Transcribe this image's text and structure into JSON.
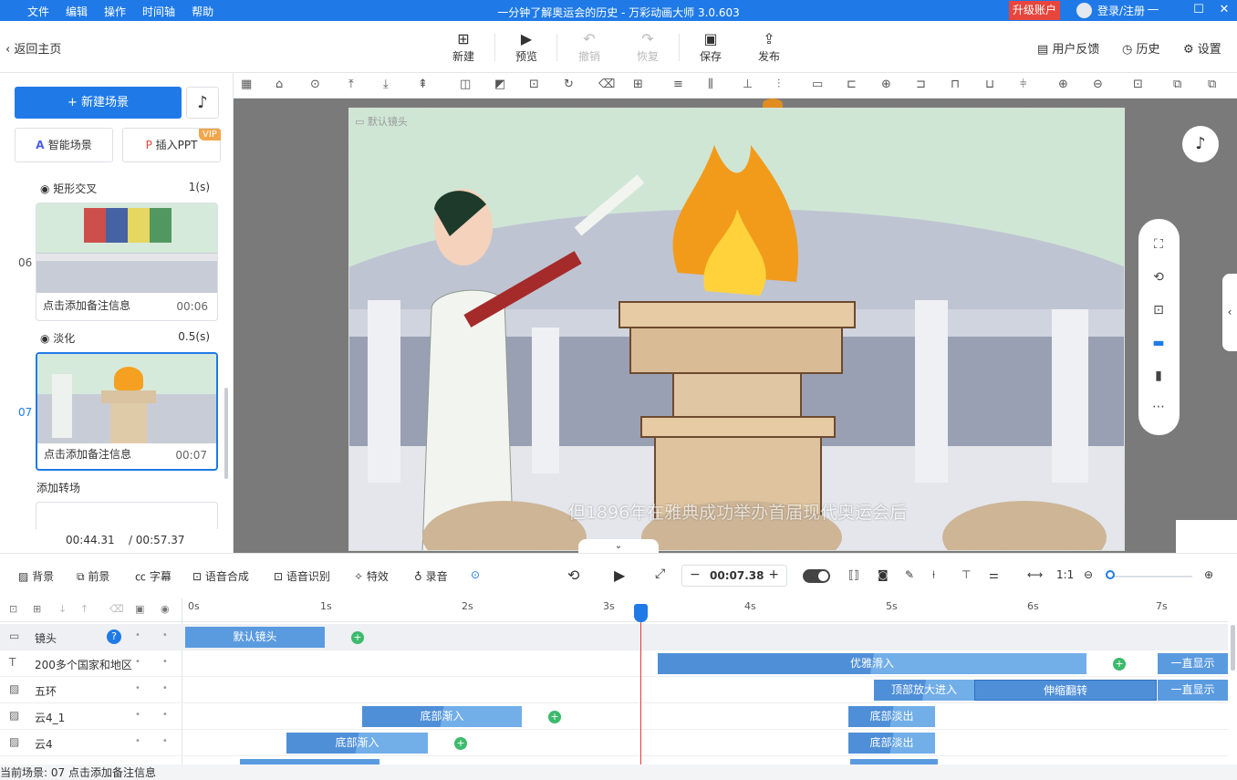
{
  "window": {
    "menu": [
      "文件",
      "编辑",
      "操作",
      "时间轴",
      "帮助"
    ],
    "title": "一分钟了解奥运会的历史 - 万彩动画大师 3.0.603",
    "upgrade": "升级账户",
    "login": "登录/注册"
  },
  "toolbar": {
    "back": "返回主页",
    "new": "新建",
    "preview": "预览",
    "undo": "撤销",
    "redo": "恢复",
    "save": "保存",
    "publish": "发布",
    "feedback": "用户反馈",
    "history": "历史",
    "settings": "设置"
  },
  "left": {
    "new_scene": "+ 新建场景",
    "smart_scene": "智能场景",
    "insert_ppt": "插入PPT",
    "vip": "VIP",
    "scenes": [
      {
        "transition": "矩形交叉",
        "transition_dur": "1(s)",
        "no": "06",
        "note": "点击添加备注信息",
        "time": "00:06"
      },
      {
        "transition": "淡化",
        "transition_dur": "0.5(s)",
        "no": "07",
        "note": "点击添加备注信息",
        "time": "00:07"
      }
    ],
    "add_transition": "添加转场",
    "current_time": "00:44.31",
    "total_time": "/ 00:57.37"
  },
  "canvas": {
    "camera_label": "默认镜头",
    "subtitle": "但1896年在雅典成功举办首届现代奥运会后"
  },
  "timeline_toolbar": {
    "bg": "背景",
    "fg": "前景",
    "caption": "字幕",
    "tts": "语音合成",
    "asr": "语音识别",
    "fx": "特效",
    "record": "录音",
    "time": "00:07.38"
  },
  "timeline": {
    "ruler": [
      "0s",
      "1s",
      "2s",
      "3s",
      "4s",
      "5s",
      "6s",
      "7s"
    ],
    "tracks": [
      {
        "name": "镜头",
        "icon": "camera",
        "clips": [
          {
            "label": "默认镜头"
          }
        ]
      },
      {
        "name": "200多个国家和地区",
        "icon": "text",
        "clips": [
          {
            "label": "优雅滑入"
          },
          {
            "label": "一直显示"
          }
        ]
      },
      {
        "name": "五环",
        "icon": "image",
        "clips": [
          {
            "label": "顶部放大进入"
          },
          {
            "label": "伸缩翻转"
          },
          {
            "label": "一直显示"
          }
        ]
      },
      {
        "name": "云4_1",
        "icon": "image",
        "clips": [
          {
            "label": "底部渐入"
          },
          {
            "label": "底部淡出"
          }
        ]
      },
      {
        "name": "云4",
        "icon": "image",
        "clips": [
          {
            "label": "底部渐入"
          },
          {
            "label": "底部淡出"
          }
        ]
      }
    ]
  },
  "status": "当前场景: 07    点击添加备注信息",
  "colors": {
    "accent": "#1f7ae8",
    "upgrade": "#e8453c",
    "clip": "#5a9be0",
    "add": "#3dba6c",
    "playhead": "#e53935"
  }
}
